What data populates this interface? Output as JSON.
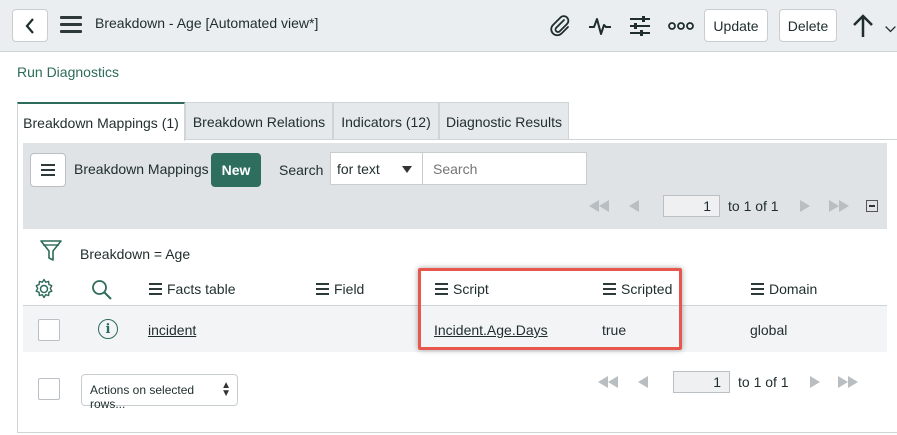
{
  "header": {
    "title": "Breakdown - Age [Automated view*]",
    "update_label": "Update",
    "delete_label": "Delete"
  },
  "related_links": {
    "run_diagnostics": "Run Diagnostics"
  },
  "tabs": [
    {
      "label": "Breakdown Mappings (1)",
      "active": true
    },
    {
      "label": "Breakdown Relations",
      "active": false
    },
    {
      "label": "Indicators (12)",
      "active": false
    },
    {
      "label": "Diagnostic Results",
      "active": false
    }
  ],
  "list": {
    "title": "Breakdown Mappings",
    "new_label": "New",
    "search_label": "Search",
    "search_field_option": "for text",
    "search_placeholder": "Search",
    "pager_top": {
      "page": "1",
      "of_text": "to 1 of 1"
    },
    "pager_bottom": {
      "page": "1",
      "of_text": "to 1 of 1"
    },
    "breadcrumb": "Breakdown = Age",
    "columns": [
      "Facts table",
      "Field",
      "Script",
      "Scripted",
      "Domain"
    ],
    "rows": [
      {
        "facts_table": "incident",
        "field": "",
        "script": "Incident.Age.Days",
        "scripted": "true",
        "domain": "global"
      }
    ],
    "actions_label": "Actions on selected rows..."
  },
  "colors": {
    "accent": "#2d6b5a",
    "new_button": "#2e6e5e",
    "highlight": "#e8574e"
  }
}
